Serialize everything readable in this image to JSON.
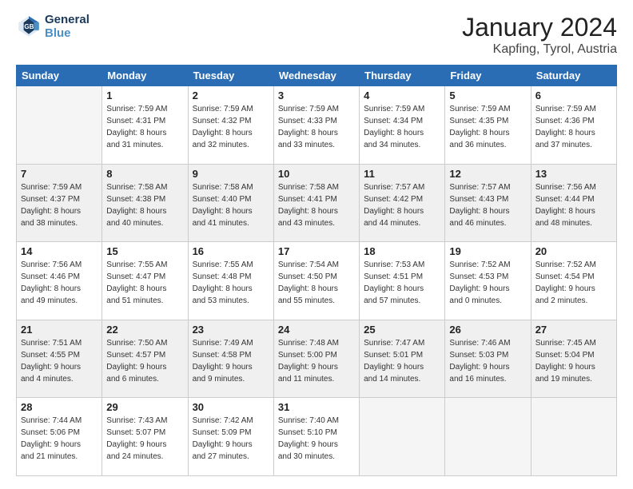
{
  "header": {
    "logo_line1": "General",
    "logo_line2": "Blue",
    "month": "January 2024",
    "location": "Kapfing, Tyrol, Austria"
  },
  "weekdays": [
    "Sunday",
    "Monday",
    "Tuesday",
    "Wednesday",
    "Thursday",
    "Friday",
    "Saturday"
  ],
  "weeks": [
    [
      {
        "day": "",
        "info": ""
      },
      {
        "day": "1",
        "info": "Sunrise: 7:59 AM\nSunset: 4:31 PM\nDaylight: 8 hours\nand 31 minutes."
      },
      {
        "day": "2",
        "info": "Sunrise: 7:59 AM\nSunset: 4:32 PM\nDaylight: 8 hours\nand 32 minutes."
      },
      {
        "day": "3",
        "info": "Sunrise: 7:59 AM\nSunset: 4:33 PM\nDaylight: 8 hours\nand 33 minutes."
      },
      {
        "day": "4",
        "info": "Sunrise: 7:59 AM\nSunset: 4:34 PM\nDaylight: 8 hours\nand 34 minutes."
      },
      {
        "day": "5",
        "info": "Sunrise: 7:59 AM\nSunset: 4:35 PM\nDaylight: 8 hours\nand 36 minutes."
      },
      {
        "day": "6",
        "info": "Sunrise: 7:59 AM\nSunset: 4:36 PM\nDaylight: 8 hours\nand 37 minutes."
      }
    ],
    [
      {
        "day": "7",
        "info": "Sunrise: 7:59 AM\nSunset: 4:37 PM\nDaylight: 8 hours\nand 38 minutes."
      },
      {
        "day": "8",
        "info": "Sunrise: 7:58 AM\nSunset: 4:38 PM\nDaylight: 8 hours\nand 40 minutes."
      },
      {
        "day": "9",
        "info": "Sunrise: 7:58 AM\nSunset: 4:40 PM\nDaylight: 8 hours\nand 41 minutes."
      },
      {
        "day": "10",
        "info": "Sunrise: 7:58 AM\nSunset: 4:41 PM\nDaylight: 8 hours\nand 43 minutes."
      },
      {
        "day": "11",
        "info": "Sunrise: 7:57 AM\nSunset: 4:42 PM\nDaylight: 8 hours\nand 44 minutes."
      },
      {
        "day": "12",
        "info": "Sunrise: 7:57 AM\nSunset: 4:43 PM\nDaylight: 8 hours\nand 46 minutes."
      },
      {
        "day": "13",
        "info": "Sunrise: 7:56 AM\nSunset: 4:44 PM\nDaylight: 8 hours\nand 48 minutes."
      }
    ],
    [
      {
        "day": "14",
        "info": "Sunrise: 7:56 AM\nSunset: 4:46 PM\nDaylight: 8 hours\nand 49 minutes."
      },
      {
        "day": "15",
        "info": "Sunrise: 7:55 AM\nSunset: 4:47 PM\nDaylight: 8 hours\nand 51 minutes."
      },
      {
        "day": "16",
        "info": "Sunrise: 7:55 AM\nSunset: 4:48 PM\nDaylight: 8 hours\nand 53 minutes."
      },
      {
        "day": "17",
        "info": "Sunrise: 7:54 AM\nSunset: 4:50 PM\nDaylight: 8 hours\nand 55 minutes."
      },
      {
        "day": "18",
        "info": "Sunrise: 7:53 AM\nSunset: 4:51 PM\nDaylight: 8 hours\nand 57 minutes."
      },
      {
        "day": "19",
        "info": "Sunrise: 7:52 AM\nSunset: 4:53 PM\nDaylight: 9 hours\nand 0 minutes."
      },
      {
        "day": "20",
        "info": "Sunrise: 7:52 AM\nSunset: 4:54 PM\nDaylight: 9 hours\nand 2 minutes."
      }
    ],
    [
      {
        "day": "21",
        "info": "Sunrise: 7:51 AM\nSunset: 4:55 PM\nDaylight: 9 hours\nand 4 minutes."
      },
      {
        "day": "22",
        "info": "Sunrise: 7:50 AM\nSunset: 4:57 PM\nDaylight: 9 hours\nand 6 minutes."
      },
      {
        "day": "23",
        "info": "Sunrise: 7:49 AM\nSunset: 4:58 PM\nDaylight: 9 hours\nand 9 minutes."
      },
      {
        "day": "24",
        "info": "Sunrise: 7:48 AM\nSunset: 5:00 PM\nDaylight: 9 hours\nand 11 minutes."
      },
      {
        "day": "25",
        "info": "Sunrise: 7:47 AM\nSunset: 5:01 PM\nDaylight: 9 hours\nand 14 minutes."
      },
      {
        "day": "26",
        "info": "Sunrise: 7:46 AM\nSunset: 5:03 PM\nDaylight: 9 hours\nand 16 minutes."
      },
      {
        "day": "27",
        "info": "Sunrise: 7:45 AM\nSunset: 5:04 PM\nDaylight: 9 hours\nand 19 minutes."
      }
    ],
    [
      {
        "day": "28",
        "info": "Sunrise: 7:44 AM\nSunset: 5:06 PM\nDaylight: 9 hours\nand 21 minutes."
      },
      {
        "day": "29",
        "info": "Sunrise: 7:43 AM\nSunset: 5:07 PM\nDaylight: 9 hours\nand 24 minutes."
      },
      {
        "day": "30",
        "info": "Sunrise: 7:42 AM\nSunset: 5:09 PM\nDaylight: 9 hours\nand 27 minutes."
      },
      {
        "day": "31",
        "info": "Sunrise: 7:40 AM\nSunset: 5:10 PM\nDaylight: 9 hours\nand 30 minutes."
      },
      {
        "day": "",
        "info": ""
      },
      {
        "day": "",
        "info": ""
      },
      {
        "day": "",
        "info": ""
      }
    ]
  ]
}
